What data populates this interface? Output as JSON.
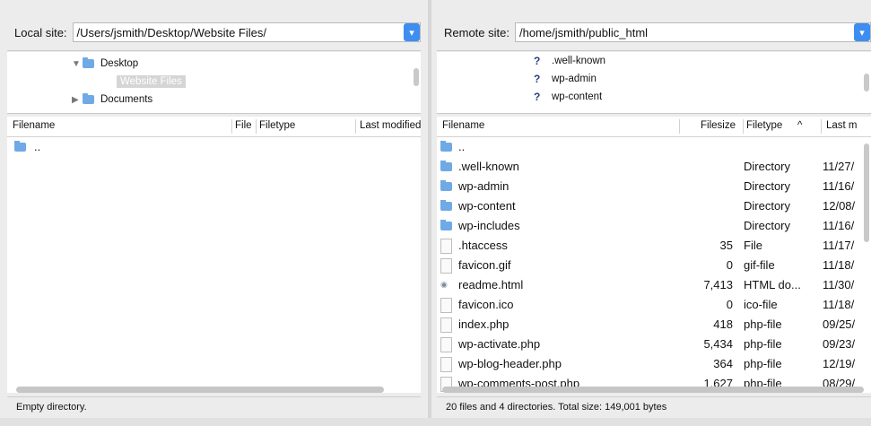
{
  "local": {
    "site_label": "Local site:",
    "site_path": "/Users/jsmith/Desktop/Website Files/",
    "tree": [
      {
        "label": "Desktop",
        "expanded": true
      },
      {
        "label": "Website Files",
        "selected": true
      },
      {
        "label": "Documents",
        "expanded": false
      }
    ],
    "columns": [
      "Filename",
      "File",
      "Filetype",
      "Last modified"
    ],
    "files": [
      {
        "name": ".."
      }
    ],
    "status": "Empty directory."
  },
  "remote": {
    "site_label": "Remote site:",
    "site_path": "/home/jsmith/public_html",
    "tree": [
      {
        "label": ".well-known"
      },
      {
        "label": "wp-admin"
      },
      {
        "label": "wp-content"
      }
    ],
    "columns": [
      "Filename",
      "Filesize",
      "Filetype",
      "Last m"
    ],
    "sort_indicator": "^",
    "files": [
      {
        "name": "..",
        "size": "",
        "type": "",
        "modified": "",
        "kind": "folder"
      },
      {
        "name": ".well-known",
        "size": "",
        "type": "Directory",
        "modified": "11/27/",
        "kind": "folder"
      },
      {
        "name": "wp-admin",
        "size": "",
        "type": "Directory",
        "modified": "11/16/",
        "kind": "folder"
      },
      {
        "name": "wp-content",
        "size": "",
        "type": "Directory",
        "modified": "12/08/",
        "kind": "folder"
      },
      {
        "name": "wp-includes",
        "size": "",
        "type": "Directory",
        "modified": "11/16/",
        "kind": "folder"
      },
      {
        "name": ".htaccess",
        "size": "35",
        "type": "File",
        "modified": "11/17/",
        "kind": "file"
      },
      {
        "name": "favicon.gif",
        "size": "0",
        "type": "gif-file",
        "modified": "11/18/",
        "kind": "file"
      },
      {
        "name": "readme.html",
        "size": "7,413",
        "type": "HTML do...",
        "modified": "11/30/",
        "kind": "html"
      },
      {
        "name": "favicon.ico",
        "size": "0",
        "type": "ico-file",
        "modified": "11/18/",
        "kind": "file"
      },
      {
        "name": "index.php",
        "size": "418",
        "type": "php-file",
        "modified": "09/25/",
        "kind": "file"
      },
      {
        "name": "wp-activate.php",
        "size": "5,434",
        "type": "php-file",
        "modified": "09/23/",
        "kind": "file"
      },
      {
        "name": "wp-blog-header.php",
        "size": "364",
        "type": "php-file",
        "modified": "12/19/",
        "kind": "file"
      },
      {
        "name": "wp-comments-post.php",
        "size": "1,627",
        "type": "php-file",
        "modified": "08/29/",
        "kind": "file"
      }
    ],
    "status": "20 files and 4 directories. Total size: 149,001 bytes"
  },
  "icons": {
    "dropdown": "chevron-down-icon",
    "folder": "folder-icon",
    "unknown": "question-icon",
    "file": "file-icon"
  },
  "colors": {
    "accent": "#3d8ef0",
    "folder": "#6fa9e6"
  }
}
